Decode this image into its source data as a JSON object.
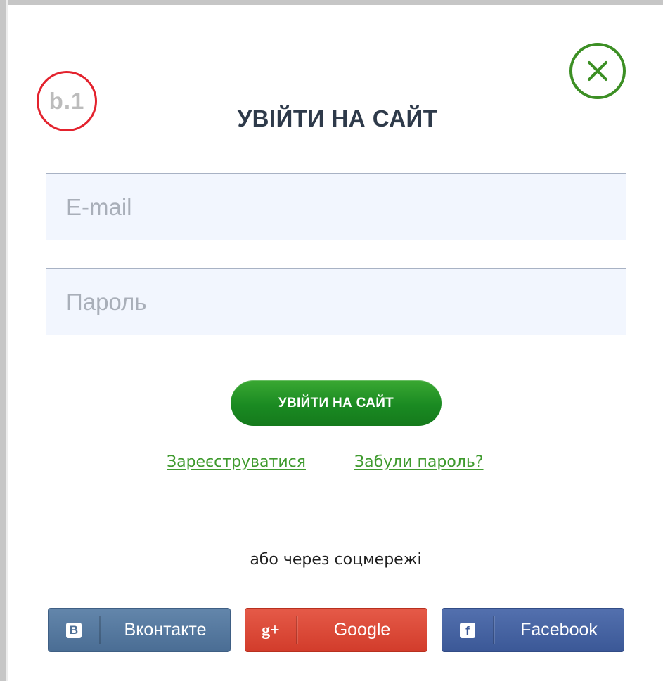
{
  "screen_badge": {
    "label": "b.1"
  },
  "modal": {
    "title": "УВІЙТИ НА САЙТ"
  },
  "form": {
    "email": {
      "placeholder": "E-mail",
      "value": ""
    },
    "password": {
      "placeholder": "Пароль",
      "value": ""
    },
    "submit_label": "УВІЙТИ НА САЙТ"
  },
  "links": {
    "register": "Зареєструватися",
    "forgot_password": "Забули пароль?"
  },
  "divider": {
    "text": "або через соцмережі"
  },
  "social": [
    {
      "label": "Вконтакте",
      "icon": "vk-icon",
      "glyph": "B",
      "color": "#4a6d94"
    },
    {
      "label": "Google",
      "icon": "google-plus-icon",
      "glyph": "g+",
      "color": "#d23c2b"
    },
    {
      "label": "Facebook",
      "icon": "facebook-icon",
      "glyph": "f",
      "color": "#3b5897"
    }
  ],
  "colors": {
    "accent_green": "#1a8a22",
    "close_green": "#3c8f24",
    "badge_red": "#e3222d",
    "link_green": "#3f9a2e"
  },
  "icons": {
    "close": "close-icon"
  }
}
